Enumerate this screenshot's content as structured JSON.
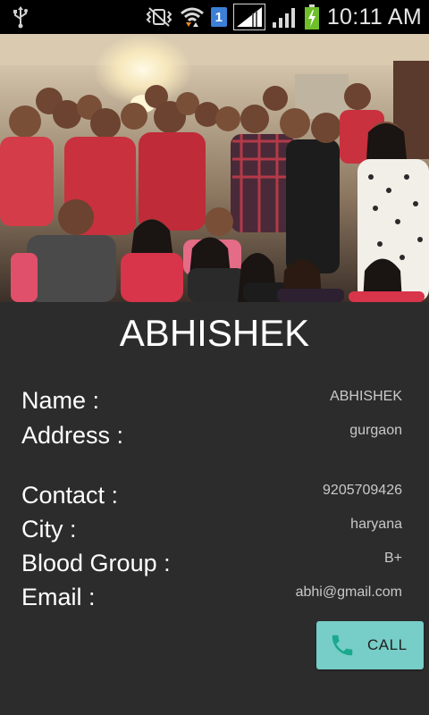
{
  "status_bar": {
    "time": "10:11 AM",
    "sim_slot": "1",
    "icons": [
      "usb-icon",
      "vibrate-icon",
      "wifi-icon",
      "sim-icon",
      "signal-icon",
      "signal-icon",
      "battery-charging-icon"
    ]
  },
  "profile": {
    "title": "ABHISHEK",
    "photo": "group-photo"
  },
  "details": {
    "name_label": "Name :",
    "name_value": "ABHISHEK",
    "address_label": "Address :",
    "address_value": "gurgaon",
    "contact_label": "Contact :",
    "contact_value": "9205709426",
    "city_label": "City :",
    "city_value": "haryana",
    "blood_label": "Blood Group :",
    "blood_value": "B+",
    "email_label": "Email :",
    "email_value": "abhi@gmail.com"
  },
  "actions": {
    "call_label": "CALL"
  },
  "colors": {
    "background": "#2c2c2c",
    "call_button": "#77cdc7",
    "phone_icon": "#1aa88f"
  }
}
